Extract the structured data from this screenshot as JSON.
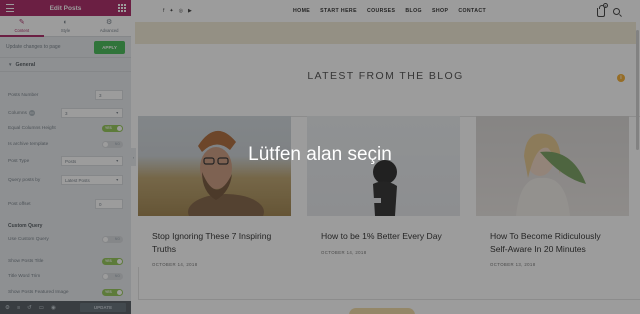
{
  "panel": {
    "title": "Edit Posts",
    "tabs": [
      {
        "label": "Content",
        "icon": "pencil-icon"
      },
      {
        "label": "Style",
        "icon": "half-circle-icon"
      },
      {
        "label": "Advanced",
        "icon": "gear-icon"
      }
    ],
    "notice": "Update changes to page",
    "apply": "APPLY",
    "section_general": "General",
    "controls": {
      "posts_number": {
        "label": "Posts Number",
        "value": "3"
      },
      "columns": {
        "label": "Columns",
        "value": "3"
      },
      "equal_columns": {
        "label": "Equal Columns Height",
        "state": "YES"
      },
      "archive_template": {
        "label": "Is archive template",
        "state": "NO"
      },
      "post_type": {
        "label": "Post Type",
        "value": "Posts"
      },
      "query_by": {
        "label": "Query posts by",
        "value": "Latest Posts"
      },
      "post_offset": {
        "label": "Post offset",
        "value": "0"
      },
      "custom_query_heading": "Custom Query",
      "use_custom_query": {
        "label": "Use Custom Query",
        "state": "NO"
      },
      "show_title": {
        "label": "Show Posts Title",
        "state": "YES"
      },
      "title_word_trim": {
        "label": "Title Word Trim",
        "state": "NO"
      },
      "show_featured": {
        "label": "Show Posts Featured Image",
        "state": "YES"
      }
    },
    "footer": {
      "update": "UPDATE"
    }
  },
  "site": {
    "nav": [
      "HOME",
      "START HERE",
      "COURSES",
      "BLOG",
      "SHOP",
      "CONTACT"
    ],
    "cart_count": "0",
    "section_title": "LATEST FROM THE BLOG",
    "posts": [
      {
        "title": "Stop Ignoring These 7 Inspiring Truths",
        "date": "OCTOBER 14, 2018"
      },
      {
        "title": "How to be 1% Better Every Day",
        "date": "OCTOBER 14, 2018"
      },
      {
        "title": "How To Become Ridiculously Self-Aware In 20 Minutes",
        "date": "OCTOBER 13, 2018"
      }
    ]
  },
  "overlay": {
    "text": "Lütfen alan seçin"
  },
  "colors": {
    "brand": "#a4195b",
    "apply": "#39b54a",
    "toggle_on": "#8bc34a"
  }
}
